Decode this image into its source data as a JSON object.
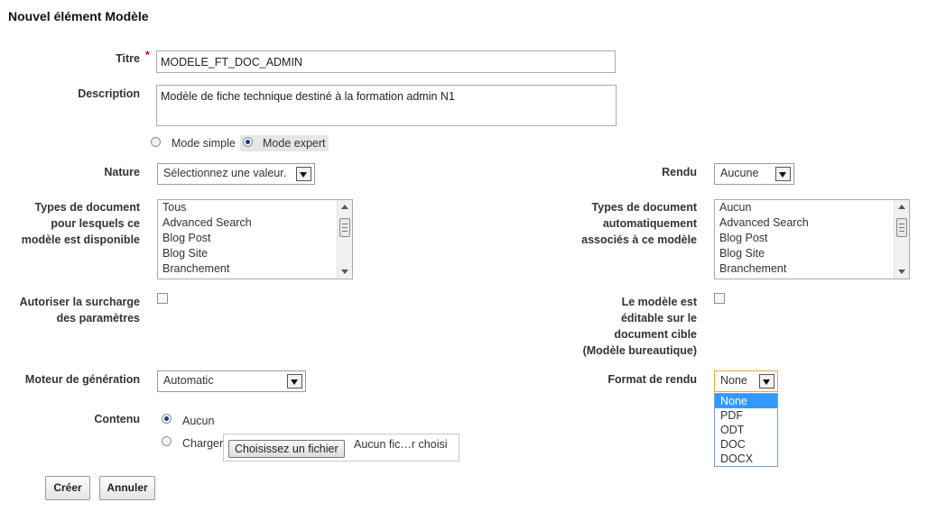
{
  "title": "Nouvel élément Modèle",
  "fields": {
    "titre": {
      "label": "Titre",
      "required_mark": "*",
      "value": "MODELE_FT_DOC_ADMIN"
    },
    "description": {
      "label": "Description",
      "value": "Modèle de fiche technique destiné à la formation admin N1"
    },
    "mode": {
      "simple_label": "Mode simple",
      "expert_label": "Mode expert",
      "selected": "expert"
    },
    "nature": {
      "label": "Nature",
      "value": "Sélectionnez une valeur."
    },
    "rendu": {
      "label": "Rendu",
      "value": "Aucune"
    },
    "types_disponible": {
      "label_lines": [
        "Types de document",
        "pour lesquels ce",
        "modèle est disponible"
      ],
      "items": [
        "Tous",
        "Advanced Search",
        "Blog Post",
        "Blog Site",
        "Branchement"
      ]
    },
    "types_auto": {
      "label_lines": [
        "Types de document",
        "automatiquement",
        "associés à ce modèle"
      ],
      "items": [
        "Aucun",
        "Advanced Search",
        "Blog Post",
        "Blog Site",
        "Branchement"
      ]
    },
    "surcharge": {
      "label_lines": [
        "Autoriser la surcharge",
        "des paramètres"
      ],
      "checked": false
    },
    "editable": {
      "label_lines": [
        "Le modèle est",
        "éditable sur le",
        "document cible",
        "(Modèle bureautique)"
      ],
      "checked": false
    },
    "moteur": {
      "label": "Moteur de génération",
      "value": "Automatic"
    },
    "format": {
      "label": "Format de rendu",
      "value": "None",
      "options": [
        "None",
        "PDF",
        "ODT",
        "DOC",
        "DOCX"
      ],
      "highlighted": "None"
    },
    "contenu": {
      "label": "Contenu",
      "aucun_label": "Aucun",
      "charger_label": "Charger",
      "selected": "aucun",
      "file_button": "Choisissez un fichier",
      "file_status": "Aucun fic…r choisi"
    }
  },
  "actions": {
    "create": "Créer",
    "cancel": "Annuler"
  }
}
